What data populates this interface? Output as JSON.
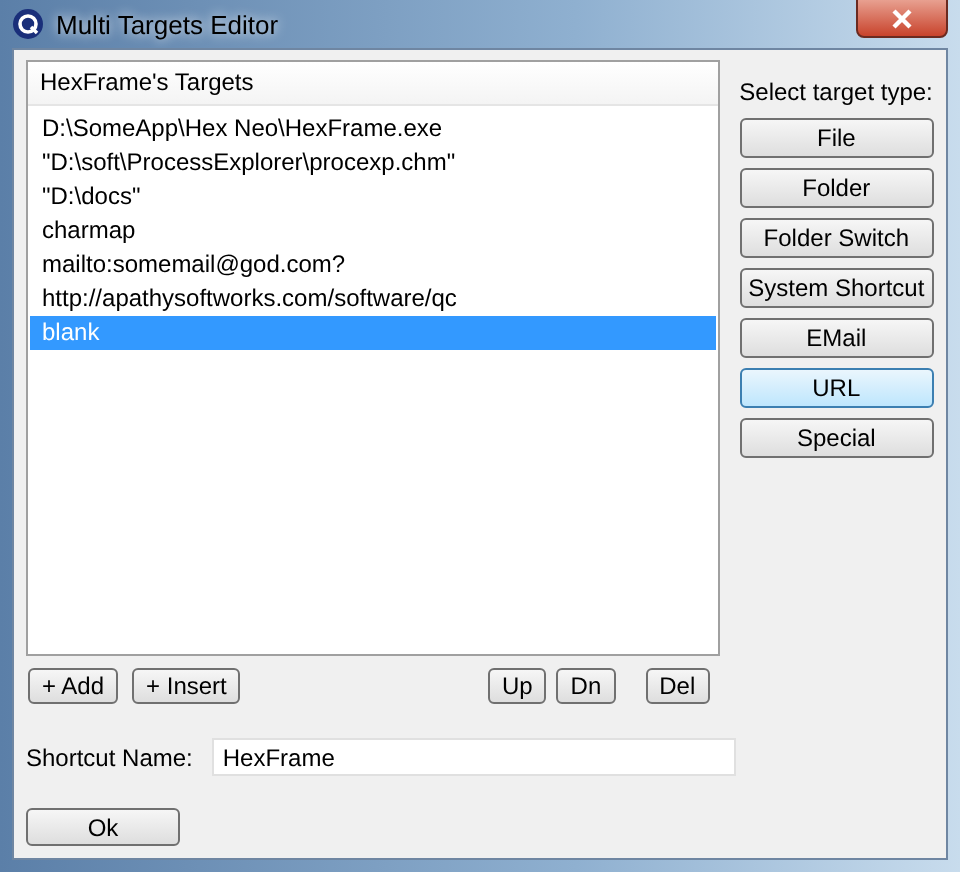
{
  "window": {
    "title": "Multi Targets Editor"
  },
  "targets": {
    "header": "HexFrame's Targets",
    "items": [
      {
        "text": "D:\\SomeApp\\Hex Neo\\HexFrame.exe",
        "selected": false
      },
      {
        "text": "\"D:\\soft\\ProcessExplorer\\procexp.chm\"",
        "selected": false
      },
      {
        "text": "\"D:\\docs\"",
        "selected": false
      },
      {
        "text": "charmap",
        "selected": false
      },
      {
        "text": "mailto:somemail@god.com?",
        "selected": false
      },
      {
        "text": "http://apathysoftworks.com/software/qc",
        "selected": false
      },
      {
        "text": "blank",
        "selected": true
      }
    ]
  },
  "target_type": {
    "label": "Select target type:",
    "buttons": [
      {
        "label": "File",
        "selected": false
      },
      {
        "label": "Folder",
        "selected": false
      },
      {
        "label": "Folder Switch",
        "selected": false
      },
      {
        "label": "System Shortcut",
        "selected": false
      },
      {
        "label": "EMail",
        "selected": false
      },
      {
        "label": "URL",
        "selected": true
      },
      {
        "label": "Special",
        "selected": false
      }
    ]
  },
  "list_buttons": {
    "left": [
      "+ Add",
      "+ Insert"
    ],
    "right": [
      "Up",
      "Dn",
      "Del"
    ]
  },
  "shortcut": {
    "label": "Shortcut Name:",
    "value": "HexFrame"
  },
  "ok_button": "Ok"
}
